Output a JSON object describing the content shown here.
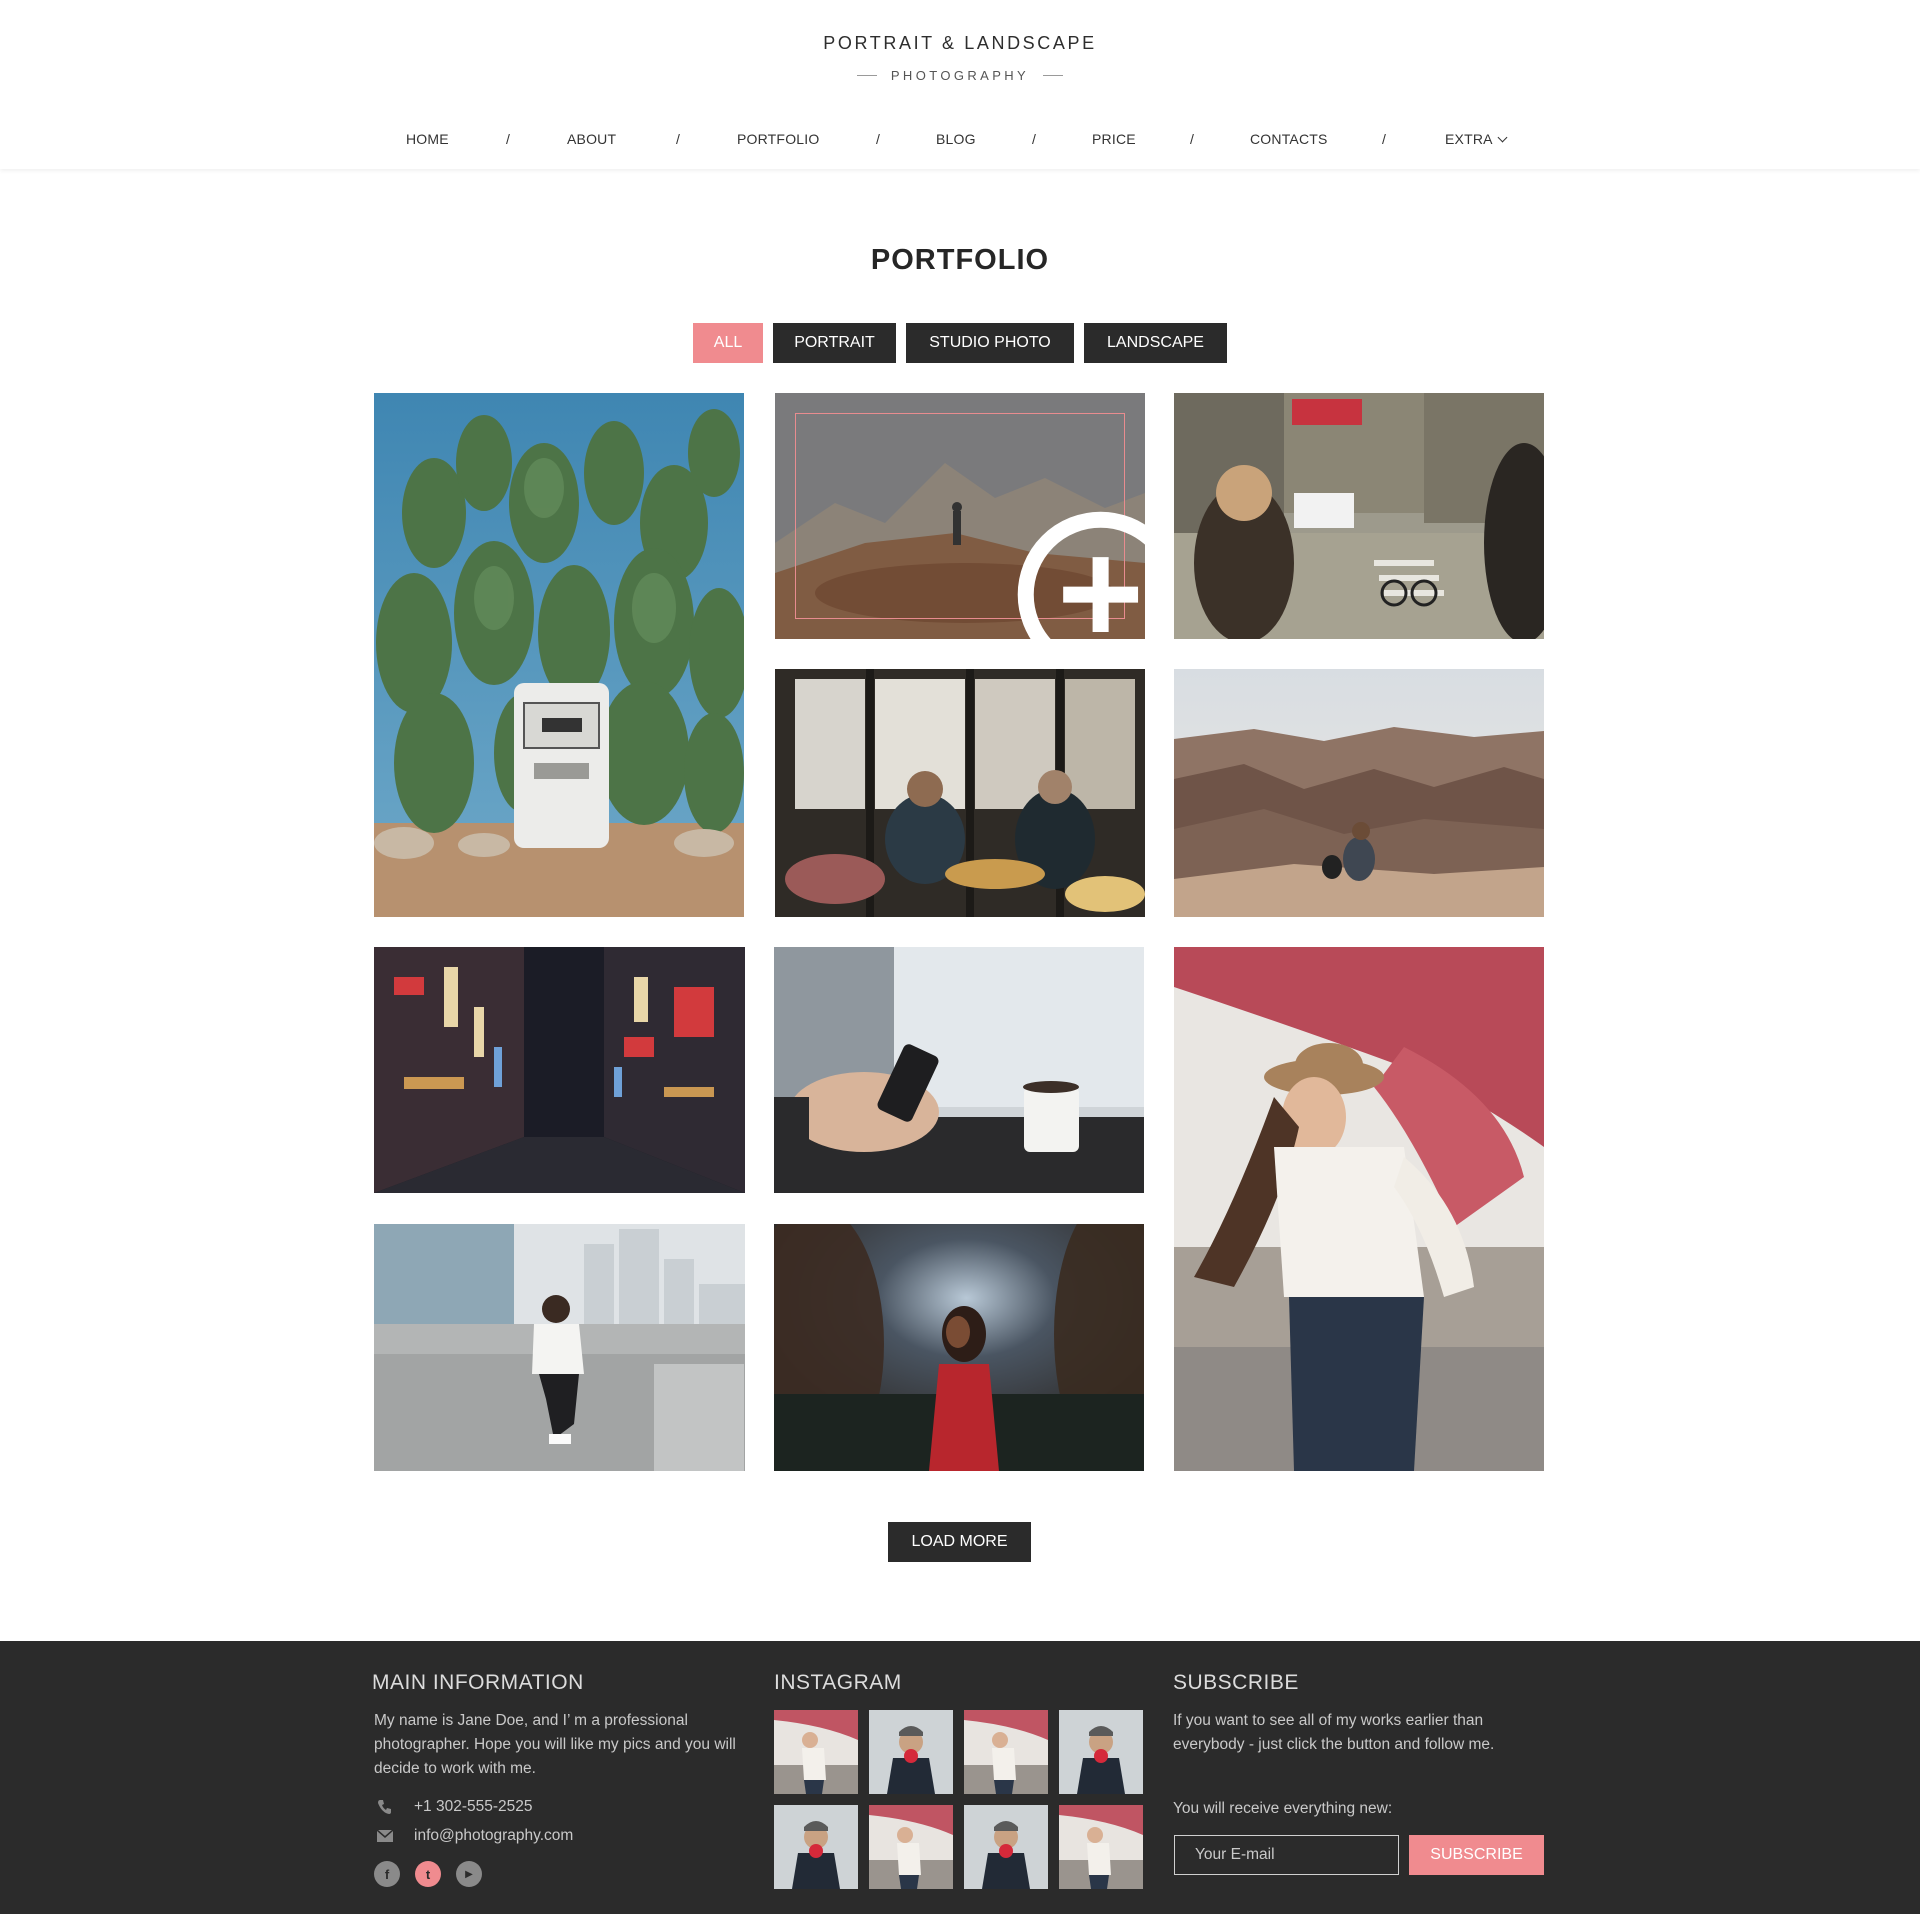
{
  "logo": {
    "title": "PORTRAIT & LANDSCAPE",
    "subtitle": "PHOTOGRAPHY"
  },
  "nav": {
    "items": [
      {
        "label": "HOME"
      },
      {
        "label": "ABOUT"
      },
      {
        "label": "PORTFOLIO"
      },
      {
        "label": "BLOG"
      },
      {
        "label": "PRICE"
      },
      {
        "label": "CONTACTS"
      },
      {
        "label": "EXTRA"
      }
    ],
    "separator": "/"
  },
  "portfolio": {
    "title": "PORTFOLIO",
    "filters": [
      {
        "label": "ALL",
        "active": true
      },
      {
        "label": "PORTRAIT",
        "active": false
      },
      {
        "label": "STUDIO PHOTO",
        "active": false
      },
      {
        "label": "LANDSCAPE",
        "active": false
      }
    ],
    "images": [
      {
        "subject": "cactus and gas pump",
        "icon": "photo-cactus"
      },
      {
        "subject": "hiker on mountain rock",
        "icon": "photo-mountain",
        "hovered": true
      },
      {
        "subject": "city street with cyclist",
        "icon": "photo-city-street"
      },
      {
        "subject": "people in a cafe",
        "icon": "photo-cafe"
      },
      {
        "subject": "person at canyon overlook",
        "icon": "photo-canyon"
      },
      {
        "subject": "neon street at night",
        "icon": "photo-neon-street"
      },
      {
        "subject": "hand holding phone with coffee",
        "icon": "photo-phone-coffee"
      },
      {
        "subject": "woman with hat and balloon",
        "icon": "photo-woman-balloon"
      },
      {
        "subject": "woman sitting on concrete wall",
        "icon": "photo-woman-wall"
      },
      {
        "subject": "woman in red in forest",
        "icon": "photo-woman-forest"
      }
    ],
    "load_more": "LOAD MORE"
  },
  "footer": {
    "main_info": {
      "heading": "MAIN INFORMATION",
      "text": "My name is Jane Doe, and I’ m a professional photographer. Hope you will like my pics and you will decide to work with me.",
      "phone": "+1 302-555-2525",
      "email": "info@photography.com"
    },
    "instagram": {
      "heading": "INSTAGRAM"
    },
    "subscribe": {
      "heading": "SUBSCRIBE",
      "text": "If you want to see all of my works earlier than everybody - just click the button and follow me.",
      "prompt": "You will receive everything new:",
      "placeholder": "Your E-mail",
      "button": "SUBSCRIBE"
    },
    "social": [
      {
        "icon": "facebook-icon",
        "glyph": "f",
        "color": "#8a8a8a"
      },
      {
        "icon": "twitter-icon",
        "glyph": "t",
        "color": "#f08b8f"
      },
      {
        "icon": "youtube-icon",
        "glyph": "▶",
        "color": "#8a8a8a"
      }
    ]
  },
  "colors": {
    "accent": "#f08b8f",
    "dark": "#2b2b2b",
    "footer_text": "#c9c9c9"
  }
}
